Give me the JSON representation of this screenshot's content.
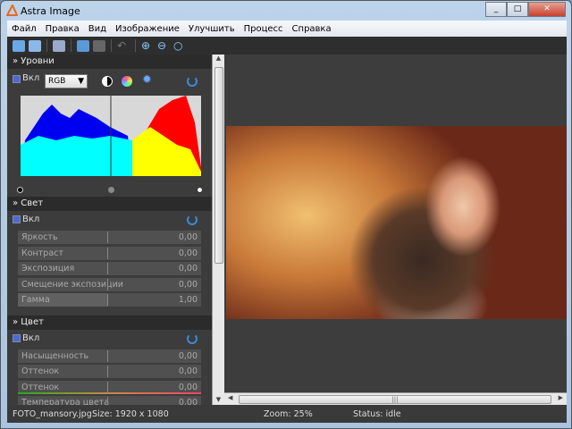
{
  "window": {
    "title": "Astra Image"
  },
  "menu": [
    "Файл",
    "Правка",
    "Вид",
    "Изображение",
    "Улучшить",
    "Процесс",
    "Справка"
  ],
  "toolbar": [
    "open-icon",
    "save-icon",
    "print-icon",
    "copy-icon",
    "paste-icon",
    "undo-icon",
    "zoom-in-icon",
    "zoom-out-icon",
    "zoom-fit-icon"
  ],
  "levels": {
    "title": "Уровни",
    "enable": "Вкл",
    "channel": "RGB"
  },
  "light": {
    "title": "Свет",
    "enable": "Вкл",
    "sliders": [
      {
        "label": "Яркость",
        "value": "0,00"
      },
      {
        "label": "Контраст",
        "value": "0,00"
      },
      {
        "label": "Экспозиция",
        "value": "0,00"
      },
      {
        "label": "Смещение экспозиции",
        "value": "0,00"
      },
      {
        "label": "Гамма",
        "value": "1,00"
      }
    ]
  },
  "color": {
    "title": "Цвет",
    "enable": "Вкл",
    "sliders": [
      {
        "label": "Насыщенность",
        "value": "0,00"
      },
      {
        "label": "Оттенок",
        "value": "0,00"
      },
      {
        "label": "Оттенок",
        "value": "0,00"
      },
      {
        "label": "Температура цвета",
        "value": "0,00"
      }
    ]
  },
  "status": {
    "file": "FOTO_mansory.jpg",
    "size": "Size: 1920 x 1080",
    "zoom": "Zoom: 25%",
    "state": "Status: idle"
  },
  "colors": {
    "accent": "#3a8ad8",
    "panel": "#3c3c3c"
  }
}
